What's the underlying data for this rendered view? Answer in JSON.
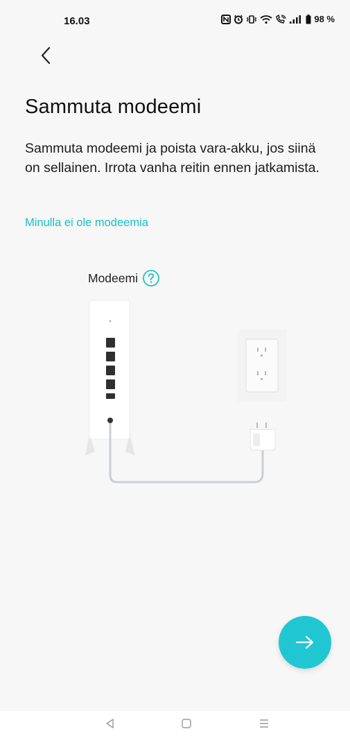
{
  "status_bar": {
    "time": "16.03",
    "battery": "98 %"
  },
  "header": {
    "back_icon": "chevron-left-icon"
  },
  "main": {
    "title": "Sammuta modeemi",
    "description": "Sammuta modeemi ja poista vara-akku, jos siinä on sellainen. Irrota vanha reitin ennen jatkamista.",
    "no_modem_link": "Minulla ei ole modeemia",
    "modem_label": "Modeemi",
    "help_icon": "help-circle-icon"
  },
  "next_button": {
    "icon": "arrow-right-icon",
    "color": "#20c7d2"
  },
  "colors": {
    "accent": "#17c1cb",
    "background": "#f7f7f7"
  },
  "nav_bar": {
    "back_icon": "triangle-back-icon",
    "home_icon": "square-home-icon",
    "menu_icon": "menu-lines-icon"
  }
}
